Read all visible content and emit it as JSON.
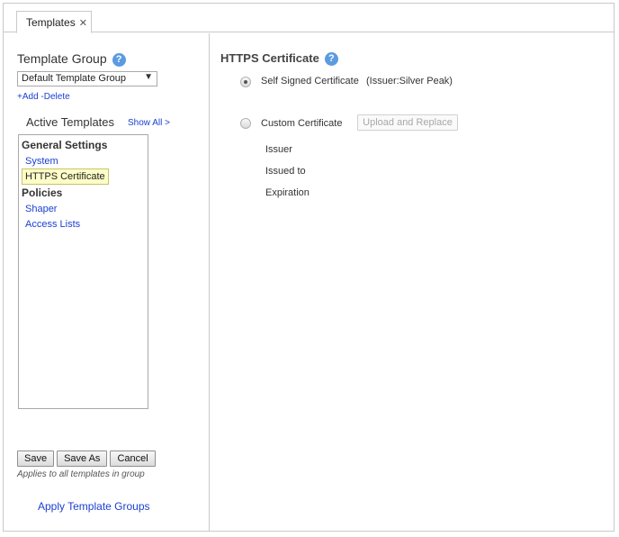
{
  "tab": {
    "label": "Templates",
    "close_glyph": "✕"
  },
  "left": {
    "template_group_label": "Template Group",
    "help_glyph": "?",
    "selected_group": "Default Template Group",
    "add_label": "+Add",
    "delete_label": "-Delete",
    "active_templates_label": "Active Templates",
    "show_all_label": "Show All >",
    "template_list": {
      "general_settings": "General Settings",
      "system": "System",
      "https_certificate": "HTTPS Certificate",
      "policies": "Policies",
      "shaper": "Shaper",
      "access_lists": "Access Lists"
    },
    "buttons": {
      "save": "Save",
      "save_as": "Save As",
      "cancel": "Cancel"
    },
    "applies_note": "Applies to all templates in group",
    "apply_template_groups": "Apply Template Groups"
  },
  "right": {
    "title": "HTTPS Certificate",
    "self_signed_label": "Self Signed Certificate",
    "issuer_note": "(Issuer:Silver Peak)",
    "custom_label": "Custom Certificate",
    "upload_button": "Upload and Replace",
    "fields": {
      "issuer": "Issuer",
      "issued_to": "Issued to",
      "expiration": "Expiration"
    },
    "selected_option": "self_signed"
  },
  "colors": {
    "link": "#1a3fd0",
    "help_icon": "#5b9be0",
    "selected_bg": "#fdfdc8"
  }
}
